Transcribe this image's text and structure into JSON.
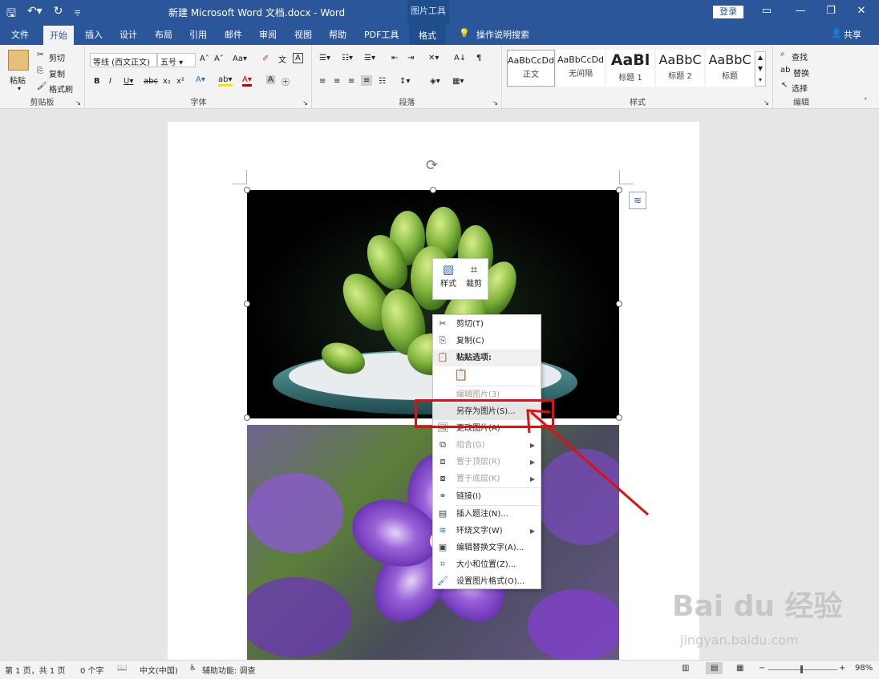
{
  "titlebar": {
    "title": "新建 Microsoft Word 文档.docx  -  Word",
    "context_tab": "图片工具",
    "login": "登录"
  },
  "tabs": [
    "文件",
    "开始",
    "插入",
    "设计",
    "布局",
    "引用",
    "邮件",
    "审阅",
    "视图",
    "帮助",
    "PDF工具",
    "格式"
  ],
  "tell_me": "操作说明搜索",
  "share": "共享",
  "ribbon": {
    "clipboard": {
      "label": "剪贴板",
      "paste": "粘贴",
      "cut": "剪切",
      "copy": "复制",
      "format_painter": "格式刷"
    },
    "font": {
      "label": "字体",
      "font_name": "等线 (西文正文)",
      "font_size": "五号"
    },
    "paragraph": {
      "label": "段落"
    },
    "styles": {
      "label": "样式",
      "items": [
        {
          "sample": "AaBbCcDd",
          "name": "正文"
        },
        {
          "sample": "AaBbCcDd",
          "name": "无间隔"
        },
        {
          "sample": "AaBl",
          "name": "标题 1"
        },
        {
          "sample": "AaBbC",
          "name": "标题 2"
        },
        {
          "sample": "AaBbC",
          "name": "标题"
        }
      ]
    },
    "editing": {
      "label": "编辑",
      "find": "查找",
      "replace": "替换",
      "select": "选择"
    }
  },
  "mini_toolbar": {
    "style": "样式",
    "crop": "裁剪"
  },
  "context_menu": {
    "cut": "剪切(T)",
    "copy": "复制(C)",
    "paste_options": "粘贴选项:",
    "edit_picture": "编辑图片(3)",
    "save_as_picture": "另存为图片(S)...",
    "change_picture": "更改图片(A)",
    "group": "组合(G)",
    "bring_to_front": "置于顶层(R)",
    "send_to_back": "置于底层(K)",
    "link": "链接(I)",
    "insert_caption": "插入题注(N)...",
    "wrap_text": "环绕文字(W)",
    "edit_alt_text": "编辑替换文字(A)...",
    "size_position": "大小和位置(Z)...",
    "format_picture": "设置图片格式(O)..."
  },
  "statusbar": {
    "page": "第 1 页，共 1 页",
    "words": "0 个字",
    "language": "中文(中国)",
    "accessibility": "辅助功能: 调查",
    "zoom": "98%"
  },
  "watermark": {
    "brand": "Bai du 经验",
    "url": "jingyan.baidu.com"
  },
  "colors": {
    "title_bar": "#2b579a",
    "highlight_box": "#e01010"
  }
}
